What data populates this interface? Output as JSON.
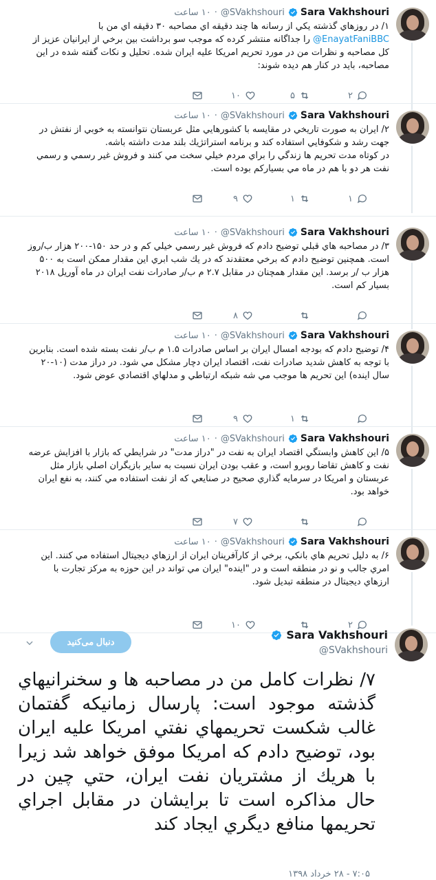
{
  "user": {
    "name": "Sara Vakhshouri",
    "handle": "@SVakhshouri"
  },
  "tweets": [
    {
      "time": "۱۰ ساعت",
      "text_before": "۱/ در روزهاي گذشته يكي از رسانه ها چند دقيقه اي مصاحبه ۳۰ دقيقه اي من با ",
      "mention": "@EnayatFaniBBC",
      "text_after": " را جداگانه منتشر كرده كه موجب سو برداشت بين برخي از ايرانيان عزيز از كل مصاحبه و نظرات من در مورد تحريم امريكا عليه ايران شده. تحليل و نكات گفته شده در اين مصاحبه، بايد در كنار هم ديده شوند:",
      "replies": "۲",
      "retweets": "۵",
      "likes": "۱۰"
    },
    {
      "time": "۱۰ ساعت",
      "text_before": "۲/ ايران به صورت تاريخي در مقايسه با كشورهايي مثل عربستان نتوانسته به خوبي از نفتش در جهت رشد و شكوفايي استفاده كند و برنامه استراتژيك بلند مدت داشته باشه.\nدر كوتاه مدت تحريم ها زندگي را براي مردم خيلي سخت مي كنند و فروش غير رسمي و رسمي نفت هر دو با هم در ماه مي بسياركم بوده است.",
      "mention": "",
      "text_after": "",
      "replies": "۱",
      "retweets": "۱",
      "likes": "۹"
    },
    {
      "time": "۱۰ ساعت",
      "text_before": "۳/ در مصاحبه هاي قبلي توضيح دادم كه فروش غير رسمي خيلي كم و در حد ۱۵۰-۲۰۰ هزار ب/روز است. همچنين توضيح دادم كه برخي معتقدند كه در يك شب ابري اين مقدار ممكن است به ۵۰۰ هزار ب /ر برسد. اين مقدار همچنان در مقابل ۲.۷ م ب/ر صادرات نفت ايران در ماه آوريل ۲۰۱۸ بسيار كم است.",
      "mention": "",
      "text_after": "",
      "replies": "",
      "retweets": "",
      "likes": "۸"
    },
    {
      "time": "۱۰ ساعت",
      "text_before": "۴/ توضيح دادم كه بودجه امسال ايران بر اساس صادرات ۱.۵ م ب/ر نفت بسته شده است. بنابرين با توجه به كاهش شديد صادرات نفت، اقتصاد ايران دچار مشكل مي شود. در دراز مدت (۱۰-۲۰ سال اينده) اين تحريم ها موجب مي شه شبكه ارتباطي و مدلهاي اقتصادي عوض شود.",
      "mention": "",
      "text_after": "",
      "replies": "",
      "retweets": "۱",
      "likes": "۹"
    },
    {
      "time": "۱۰ ساعت",
      "text_before": "۵/ اين كاهش وابستگي اقتصاد ايران به نفت در \"دراز مدت\" در شرايطي كه بازار با افزايش عرضه نفت و كاهش تقاضا روبرو است، و عقب بودن ايران نسبت به ساير بازيگران اصلي بازار مثل عربستان و امريكا در سرمايه گذاري صحيح در صنايعي كه از نفت استفاده مي كنند، به نفع ايران خواهد بود.",
      "mention": "",
      "text_after": "",
      "replies": "",
      "retweets": "",
      "likes": "۷"
    },
    {
      "time": "۱۰ ساعت",
      "text_before": "۶/ به دليل تحريم هاي بانكي، برخي از كارآفرينان ايران از ارزهاي ديجيتال استفاده مي كنند. اين امري جالب و نو در منطقه است و در \"اينده\" ايران مي تواند در اين حوزه به مركز تجارت با ارزهاي ديجيتال در منطقه تبديل شود.",
      "mention": "",
      "text_after": "",
      "replies": "۲",
      "retweets": "",
      "likes": "۱۰"
    }
  ],
  "main_tweet": {
    "follow_label": "دنبال می‌کنید",
    "text": "۷/ نظرات كامل من در مصاحبه ها و سخنرانيهاي گذشته موجود است: پارسال زمانيكه گفتمان غالب شكست تحريمهاي نفتي امريكا عليه ايران بود، توضيح دادم كه امريكا موفق خواهد شد زيرا با هريك از مشتريان نفت ايران، حتي چين در حال مذاكره است تا برايشان در مقابل اجراي تحريمها منافع ديگري ايجاد كند",
    "timestamp": "۷:۰۵ - ۲۸ خرداد ۱۳۹۸"
  },
  "colors": {
    "accent": "#1b95e0",
    "follow_bg": "#8fc9ee",
    "muted": "#657786"
  },
  "icons": [
    "reply-icon",
    "retweet-icon",
    "like-icon",
    "message-icon",
    "verified-badge-icon",
    "chevron-down-icon"
  ]
}
